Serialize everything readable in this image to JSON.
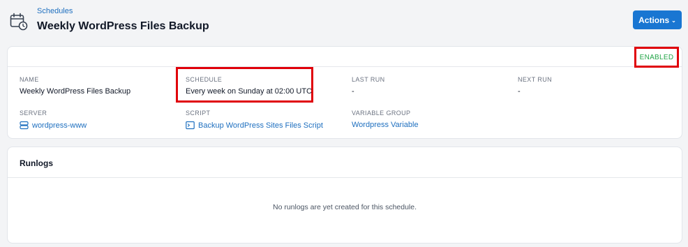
{
  "header": {
    "breadcrumb": "Schedules",
    "title": "Weekly WordPress Files Backup",
    "actions_label": "Actions"
  },
  "details": {
    "status": "ENABLED",
    "name_label": "NAME",
    "name_value": "Weekly WordPress Files Backup",
    "schedule_label": "SCHEDULE",
    "schedule_value": "Every week on Sunday at 02:00 UTC",
    "last_run_label": "LAST RUN",
    "last_run_value": "-",
    "next_run_label": "NEXT RUN",
    "next_run_value": "-",
    "server_label": "SERVER",
    "server_value": "wordpress-www",
    "script_label": "SCRIPT",
    "script_value": "Backup WordPress Sites Files Script",
    "variable_group_label": "VARIABLE GROUP",
    "variable_group_value": "Wordpress Variable"
  },
  "runlogs": {
    "title": "Runlogs",
    "empty_message": "No runlogs are yet created for this schedule."
  },
  "colors": {
    "accent": "#1976d2",
    "link": "#1e6fbf",
    "enabled": "#22a447",
    "highlight": "#e0000a"
  },
  "icons": {
    "page": "calendar-clock-icon",
    "server": "server-icon",
    "script": "terminal-icon",
    "actions": "chevron-down-icon"
  }
}
